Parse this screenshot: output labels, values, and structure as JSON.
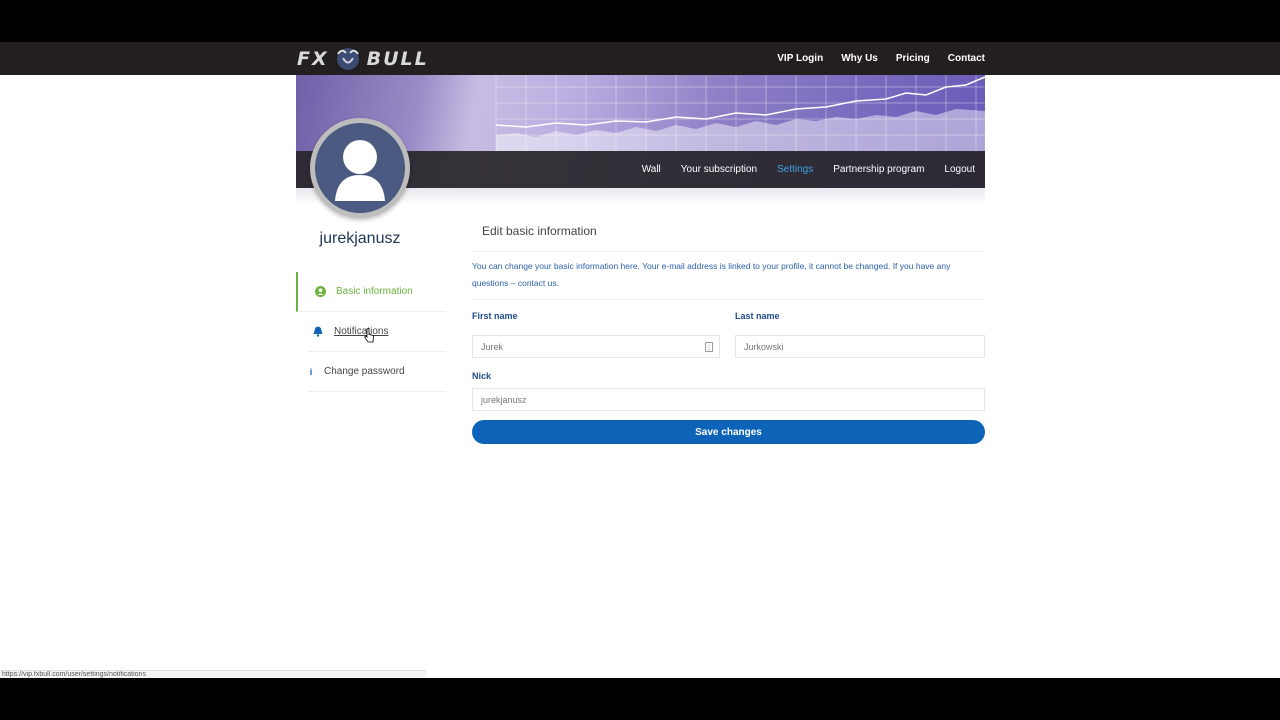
{
  "logo": {
    "left": "FX",
    "right": "BULL"
  },
  "topnav": {
    "items": [
      "VIP Login",
      "Why Us",
      "Pricing",
      "Contact"
    ]
  },
  "subnav": {
    "items": [
      "Wall",
      "Your subscription",
      "Settings",
      "Partnership program",
      "Logout"
    ],
    "active": "Settings"
  },
  "profile": {
    "username": "jurekjanusz"
  },
  "sidemenu": {
    "items": [
      {
        "label": "Basic information",
        "icon": "user-circle-icon",
        "active": true
      },
      {
        "label": "Notifications",
        "icon": "bell-icon"
      },
      {
        "label": "Change password",
        "icon": "info-icon"
      }
    ]
  },
  "content": {
    "title": "Edit basic information",
    "info": "You can change your basic information here. Your e-mail address is linked to your profile, it cannot be changed. If you have any questions – contact us."
  },
  "form": {
    "first_name_label": "First name",
    "first_name_value": "Jurek",
    "last_name_label": "Last name",
    "last_name_value": "Jurkowski",
    "nick_label": "Nick",
    "nick_value": "jurekjanusz",
    "save_label": "Save changes"
  },
  "statusbar": {
    "url": "https://vip.fxbull.com/user/settings/notifications"
  },
  "colors": {
    "accent_green": "#6db33f",
    "accent_blue": "#0d63b8",
    "link_blue": "#3da4e6",
    "nav_dark": "#231f20"
  }
}
